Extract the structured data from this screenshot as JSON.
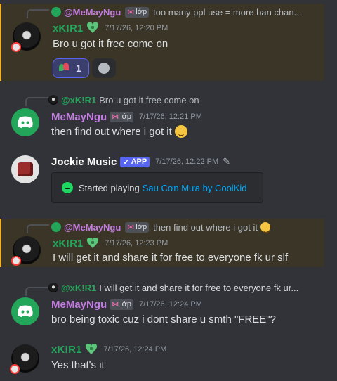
{
  "colors": {
    "user_xkir1": "#23a55a",
    "user_memayngu": "#c27ce0",
    "user_jockie": "#ffffff",
    "link": "#00a8fc",
    "highlight": "#f0b232"
  },
  "messages": [
    {
      "reply": {
        "name": "@MeMayNgu",
        "tag": "lớp",
        "text": "too many ppl use = more ban chan..."
      },
      "author": "xK!R1",
      "timestamp": "7/17/26, 12:20 PM",
      "text": "Bro u got it free come on",
      "reactions": [
        {
          "icon": "flower-emoji",
          "count": "1"
        },
        {
          "icon": "add-reaction-icon"
        }
      ]
    },
    {
      "reply": {
        "name": "@xK!R1",
        "text": "Bro u got it free come on"
      },
      "author": "MeMayNgu",
      "tag": "lớp",
      "timestamp": "7/17/26, 12:21 PM",
      "text": "then find out where i got it",
      "emoji": "wink-emoji"
    },
    {
      "author": "Jockie Music",
      "badge": "APP",
      "timestamp": "7/17/26, 12:22 PM",
      "embed": {
        "prefix": "Started playing",
        "song": "Sau Cơn Mưa by CoolKid"
      }
    },
    {
      "reply": {
        "name": "@MeMayNgu",
        "tag": "lớp",
        "text": "then find out where i got it",
        "emoji": "wink-emoji"
      },
      "author": "xK!R1",
      "timestamp": "7/17/26, 12:23 PM",
      "text": "I will get it and share it for free to everyone fk ur slf"
    },
    {
      "reply": {
        "name": "@xK!R1",
        "text": "I will get it and share it for free to everyone fk ur..."
      },
      "author": "MeMayNgu",
      "tag": "lớp",
      "timestamp": "7/17/26, 12:24 PM",
      "text": "bro being toxic cuz i dont share u smth \"FREE\"?"
    },
    {
      "author": "xK!R1",
      "timestamp": "7/17/26, 12:24 PM",
      "text": "Yes that's it"
    }
  ]
}
